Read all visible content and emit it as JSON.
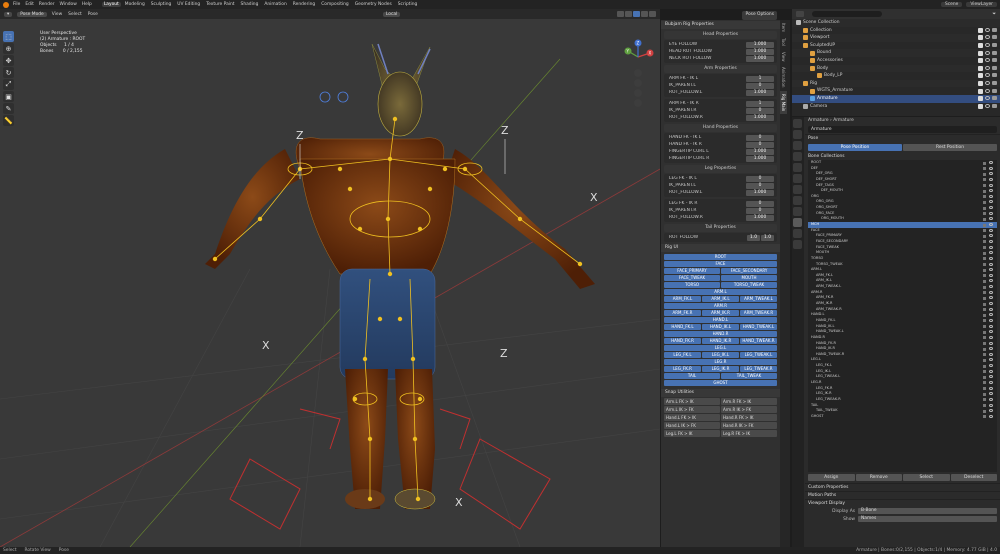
{
  "menubar": {
    "menus": [
      "File",
      "Edit",
      "Render",
      "Window",
      "Help"
    ],
    "workspaces": [
      "Layout",
      "Modeling",
      "Sculpting",
      "UV Editing",
      "Texture Paint",
      "Shading",
      "Animation",
      "Rendering",
      "Compositing",
      "Geometry Nodes",
      "Scripting"
    ],
    "active_workspace": "Layout",
    "scene": "Scene",
    "view_layer": "ViewLayer"
  },
  "viewport": {
    "mode": "Pose Mode",
    "menus": [
      "View",
      "Select",
      "Pose"
    ],
    "orientation": "Local",
    "overlay": {
      "line1": "User Perspective",
      "line2": "(2) Armature : ROOT",
      "line3_label": "Objects",
      "line3_value": "1 / 4",
      "line4_label": "Bones",
      "line4_value": "0 / 2,155"
    },
    "pose_options": "Pose Options",
    "gizmo": {
      "x": "X",
      "y": "Y",
      "z": "Z"
    },
    "colors": {
      "bg": "#393939",
      "skin": "#7a3a10",
      "shorts": "#2c4470",
      "bones": "#f0c020",
      "select": "#e6e600"
    }
  },
  "npanel": {
    "tabs": [
      "Item",
      "Tool",
      "View",
      "Animation",
      "Rig Main"
    ],
    "title": "Bubjam Rig Properties",
    "head_header": "Head Properties",
    "head_props": [
      {
        "label": "EYE FOLLOW",
        "value": "1.000"
      },
      {
        "label": "HEAD ROT FOLLOW",
        "value": "1.000"
      },
      {
        "label": "NECK ROT FOLLOW",
        "value": "1.000"
      }
    ],
    "arm_header": "Arm Properties",
    "arm_l": [
      {
        "label": "ARM FK - IK L",
        "value": "1"
      },
      {
        "label": "IK_PARENT.L",
        "value": "0"
      },
      {
        "label": "ROT_FOLLOW.L",
        "value": "1.000"
      }
    ],
    "arm_r": [
      {
        "label": "ARM FK - IK R",
        "value": "1"
      },
      {
        "label": "IK_PARENT.R",
        "value": "0"
      },
      {
        "label": "ROT_FOLLOW.R",
        "value": "1.000"
      }
    ],
    "hand_header": "Hand Properties",
    "hand": [
      {
        "label": "HAND FK - IK L",
        "value": "0"
      },
      {
        "label": "HAND FK - IK R",
        "value": "0"
      },
      {
        "label": "FINGERTIP CURL L",
        "value": "1.000"
      },
      {
        "label": "FINGERTIP CURL R",
        "value": "1.000"
      }
    ],
    "leg_header": "Leg Properties",
    "leg_l": [
      {
        "label": "LEG FK - IK L",
        "value": "0"
      },
      {
        "label": "IK_PARENT.L",
        "value": "0"
      },
      {
        "label": "ROT_FOLLOW.L",
        "value": "1.000"
      }
    ],
    "leg_r": [
      {
        "label": "LEG FK - IK R",
        "value": "0"
      },
      {
        "label": "IK_PARENT.R",
        "value": "0"
      },
      {
        "label": "ROT_FOLLOW.R",
        "value": "1.000"
      }
    ],
    "tail_header": "Tail Properties",
    "tail": {
      "label": "ROT FOLLOW",
      "v1": "1.0",
      "v2": "1.0"
    },
    "rigui_header": "Rig UI",
    "rig_rows": [
      [
        "ROOT"
      ],
      [
        "FACE"
      ],
      [
        "FACE_PRIMARY",
        "FACE_SECONDARY"
      ],
      [
        "FACE_TWEAK",
        "MOUTH"
      ],
      [
        "TORSO",
        "TORSO_TWEAK"
      ],
      [
        "ARM.L"
      ],
      [
        "ARM_FK.L",
        "ARM_IK.L",
        "ARM_TWEAK.L"
      ],
      [
        "ARM.R"
      ],
      [
        "ARM_FK.R",
        "ARM_IK.R",
        "ARM_TWEAK.R"
      ],
      [
        "HAND.L"
      ],
      [
        "HAND_FK.L",
        "HAND_IK.L",
        "HAND_TWEAK.L"
      ],
      [
        "HAND.R"
      ],
      [
        "HAND_FK.R",
        "HAND_IK.R",
        "HAND_TWEAK.R"
      ],
      [
        "LEG.L"
      ],
      [
        "LEG_FK.L",
        "LEG_IK.L",
        "LEG_TWEAK.L"
      ],
      [
        "LEG.R"
      ],
      [
        "LEG_FK.R",
        "LEG_IK.R",
        "LEG_TWEAK.R"
      ],
      [
        "TAIL",
        "TAIL_TWEAK"
      ],
      [
        "GHOST"
      ]
    ],
    "snap_header": "Snap Utilities",
    "snap_rows": [
      [
        "Arm.L FK > IK",
        "Arm.R FK > IK"
      ],
      [
        "Arm.L IK > FK",
        "Arm.R IK > FK"
      ],
      [
        "Hand.L FK > IK",
        "Hand.R FK > IK"
      ],
      [
        "Hand.L IK > FK",
        "Hand.R IK > FK"
      ],
      [
        "Leg.L FK > IK",
        "Leg.R FK > IK"
      ]
    ]
  },
  "outliner": {
    "rows": [
      {
        "name": "Scene Collection",
        "indent": 0,
        "sel": false,
        "tail": ""
      },
      {
        "name": "Collection",
        "indent": 1,
        "sel": false,
        "tail": "ck"
      },
      {
        "name": "Viewport",
        "indent": 1,
        "sel": false,
        "tail": "ck"
      },
      {
        "name": "SculptedUP",
        "indent": 1,
        "sel": false,
        "tail": "ck"
      },
      {
        "name": "Bound",
        "indent": 2,
        "sel": false,
        "tail": "ck"
      },
      {
        "name": "Accessories",
        "indent": 2,
        "sel": false,
        "tail": "ck"
      },
      {
        "name": "Body",
        "indent": 2,
        "sel": false,
        "tail": "ck"
      },
      {
        "name": "Body_LP",
        "indent": 3,
        "sel": false,
        "tail": "ck"
      },
      {
        "name": "Rig",
        "indent": 1,
        "sel": false,
        "tail": "ck"
      },
      {
        "name": "WGTS_Armature",
        "indent": 2,
        "sel": false,
        "tail": "ck"
      },
      {
        "name": "Armature",
        "indent": 2,
        "sel": true,
        "tail": "ck"
      },
      {
        "name": "Camera",
        "indent": 1,
        "sel": false,
        "tail": "ck"
      }
    ]
  },
  "properties": {
    "breadcrumb": [
      "Armature",
      "Armature"
    ],
    "name_field": "Armature",
    "pose_header": "Pose",
    "pose_tabs": [
      "Pose Position",
      "Rest Position"
    ],
    "bone_collections_header": "Bone Collections",
    "bone_collections": [
      {
        "name": "ROOT",
        "d": 0
      },
      {
        "name": "DEF",
        "d": 0
      },
      {
        "name": "DEF_ORG",
        "d": 1
      },
      {
        "name": "DEF_SHORT",
        "d": 1
      },
      {
        "name": "DEF_TAGS",
        "d": 1
      },
      {
        "name": "DEF_MOUTH",
        "d": 2
      },
      {
        "name": "ORG",
        "d": 0
      },
      {
        "name": "ORG_ORG",
        "d": 1
      },
      {
        "name": "ORG_SHORT",
        "d": 1
      },
      {
        "name": "ORG_FACE",
        "d": 1
      },
      {
        "name": "ORG_MOUTH",
        "d": 2
      },
      {
        "name": "MCH",
        "d": 0,
        "sel": true
      },
      {
        "name": "FACE",
        "d": 0
      },
      {
        "name": "FACE_PRIMARY",
        "d": 1
      },
      {
        "name": "FACE_SECONDARY",
        "d": 1
      },
      {
        "name": "FACE_TWEAK",
        "d": 1
      },
      {
        "name": "MOUTH",
        "d": 1
      },
      {
        "name": "TORSO",
        "d": 0
      },
      {
        "name": "TORSO_TWEAK",
        "d": 1
      },
      {
        "name": "ARM.L",
        "d": 0
      },
      {
        "name": "ARM_FK.L",
        "d": 1
      },
      {
        "name": "ARM_IK.L",
        "d": 1
      },
      {
        "name": "ARM_TWEAK.L",
        "d": 1
      },
      {
        "name": "ARM.R",
        "d": 0
      },
      {
        "name": "ARM_FK.R",
        "d": 1
      },
      {
        "name": "ARM_IK.R",
        "d": 1
      },
      {
        "name": "ARM_TWEAK.R",
        "d": 1
      },
      {
        "name": "HAND.L",
        "d": 0
      },
      {
        "name": "HAND_FK.L",
        "d": 1
      },
      {
        "name": "HAND_IK.L",
        "d": 1
      },
      {
        "name": "HAND_TWEAK.L",
        "d": 1
      },
      {
        "name": "HAND.R",
        "d": 0
      },
      {
        "name": "HAND_FK.R",
        "d": 1
      },
      {
        "name": "HAND_IK.R",
        "d": 1
      },
      {
        "name": "HAND_TWEAK.R",
        "d": 1
      },
      {
        "name": "LEG.L",
        "d": 0
      },
      {
        "name": "LEG_FK.L",
        "d": 1
      },
      {
        "name": "LEG_IK.L",
        "d": 1
      },
      {
        "name": "LEG_TWEAK.L",
        "d": 1
      },
      {
        "name": "LEG.R",
        "d": 0
      },
      {
        "name": "LEG_FK.R",
        "d": 1
      },
      {
        "name": "LEG_IK.R",
        "d": 1
      },
      {
        "name": "LEG_TWEAK.R",
        "d": 1
      },
      {
        "name": "TAIL",
        "d": 0
      },
      {
        "name": "TAIL_TWEAK",
        "d": 1
      },
      {
        "name": "GHOST",
        "d": 0
      }
    ],
    "bc_buttons": [
      "Assign",
      "Remove",
      "Select",
      "Deselect"
    ],
    "custom_props": "Custom Properties",
    "motion_paths": "Motion Paths",
    "viewport_display": "Viewport Display",
    "display_as_label": "Display As",
    "display_as_value": "B-Bone",
    "show_label": "Show",
    "show_value": "Names"
  },
  "statusbar": {
    "left": [
      "Select",
      "Rotate View",
      "Pose"
    ],
    "right": "Armature | Bones:0/2,155 | Objects:1/4 | Memory: 4.77 GiB | 4.0"
  }
}
